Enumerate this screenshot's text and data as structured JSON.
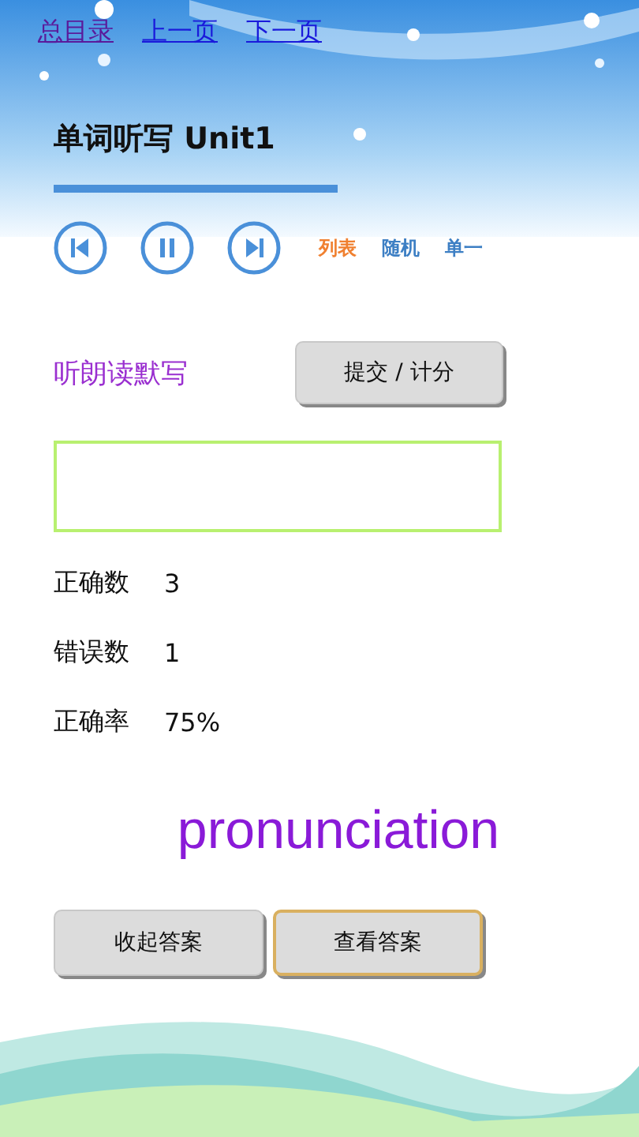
{
  "nav_links": [
    {
      "label": "总目录",
      "visited": true
    },
    {
      "label": "上一页",
      "visited": false
    },
    {
      "label": "下一页",
      "visited": false
    }
  ],
  "title": "单词听写 Unit1",
  "player": {
    "controls": [
      {
        "kind": "previous"
      },
      {
        "kind": "pause"
      },
      {
        "kind": "next"
      }
    ],
    "modes": [
      {
        "label": "列表",
        "selected": true
      },
      {
        "label": "随机",
        "selected": false
      },
      {
        "label": "单一",
        "selected": false
      }
    ]
  },
  "dictation": {
    "label": "听朗读默写",
    "submit_button": "提交 / 计分"
  },
  "stats": [
    {
      "label": "正确数",
      "value": "3"
    },
    {
      "label": "错误数",
      "value": "1"
    },
    {
      "label": "正确率",
      "value": "75%"
    }
  ],
  "word": "pronunciation",
  "buttons": [
    {
      "label": "收起答案",
      "selected": false
    },
    {
      "label": "查看答案",
      "selected": true
    }
  ]
}
